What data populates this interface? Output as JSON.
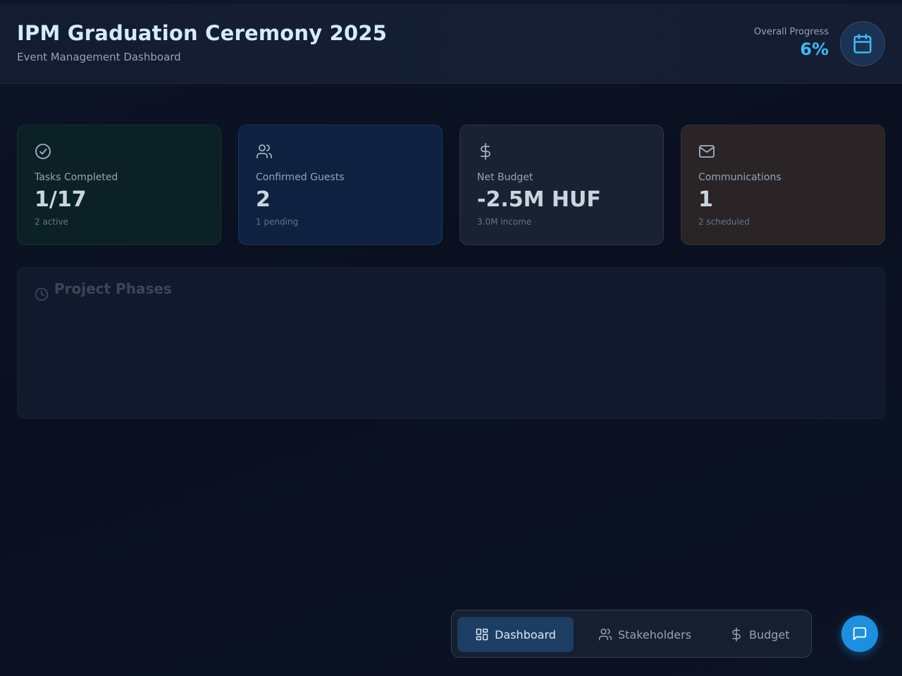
{
  "header": {
    "title": "IPM Graduation Ceremony 2025",
    "subtitle": "Event Management Dashboard",
    "progress_label": "Overall Progress",
    "progress_value": "6%",
    "progress_fraction": 0.06
  },
  "stats": [
    {
      "label": "Tasks Completed",
      "value": "1/17",
      "sub": "2 active",
      "icon": "check-circle-icon"
    },
    {
      "label": "Confirmed Guests",
      "value": "2",
      "sub": "1 pending",
      "icon": "users-icon"
    },
    {
      "label": "Net Budget",
      "value": "-2.5M HUF",
      "sub": "3.0M income",
      "icon": "dollar-icon"
    },
    {
      "label": "Communications",
      "value": "1",
      "sub": "2 scheduled",
      "icon": "mail-icon"
    }
  ],
  "phases": {
    "title": "Project Phases",
    "icon": "clock-icon"
  },
  "nav": {
    "items": [
      {
        "label": "Dashboard",
        "icon": "dashboard-icon",
        "active": true
      },
      {
        "label": "Stakeholders",
        "icon": "users-icon",
        "active": false
      },
      {
        "label": "Budget",
        "icon": "dollar-icon",
        "active": false
      }
    ]
  },
  "colors": {
    "accent": "#38bdf8",
    "nav_active": "#1c3e64",
    "chat_button": "#1d8fe0"
  }
}
